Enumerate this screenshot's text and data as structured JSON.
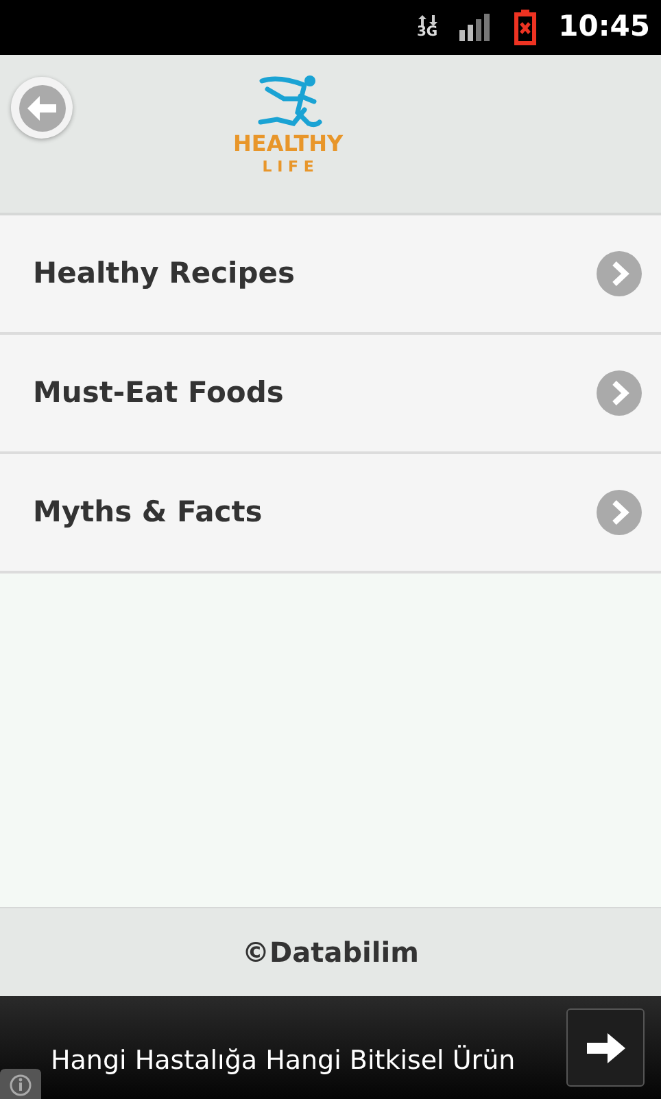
{
  "status_bar": {
    "network": "3G",
    "time": "10:45"
  },
  "header": {
    "logo_title": "HEALTHY",
    "logo_subtitle": "L I F E"
  },
  "menu": [
    {
      "label": "Healthy Recipes"
    },
    {
      "label": "Must-Eat Foods"
    },
    {
      "label": "Myths & Facts"
    }
  ],
  "footer": {
    "text": "©Databilim"
  },
  "ad": {
    "text": "Hangi Hastalığa Hangi Bitkisel Ürün"
  }
}
